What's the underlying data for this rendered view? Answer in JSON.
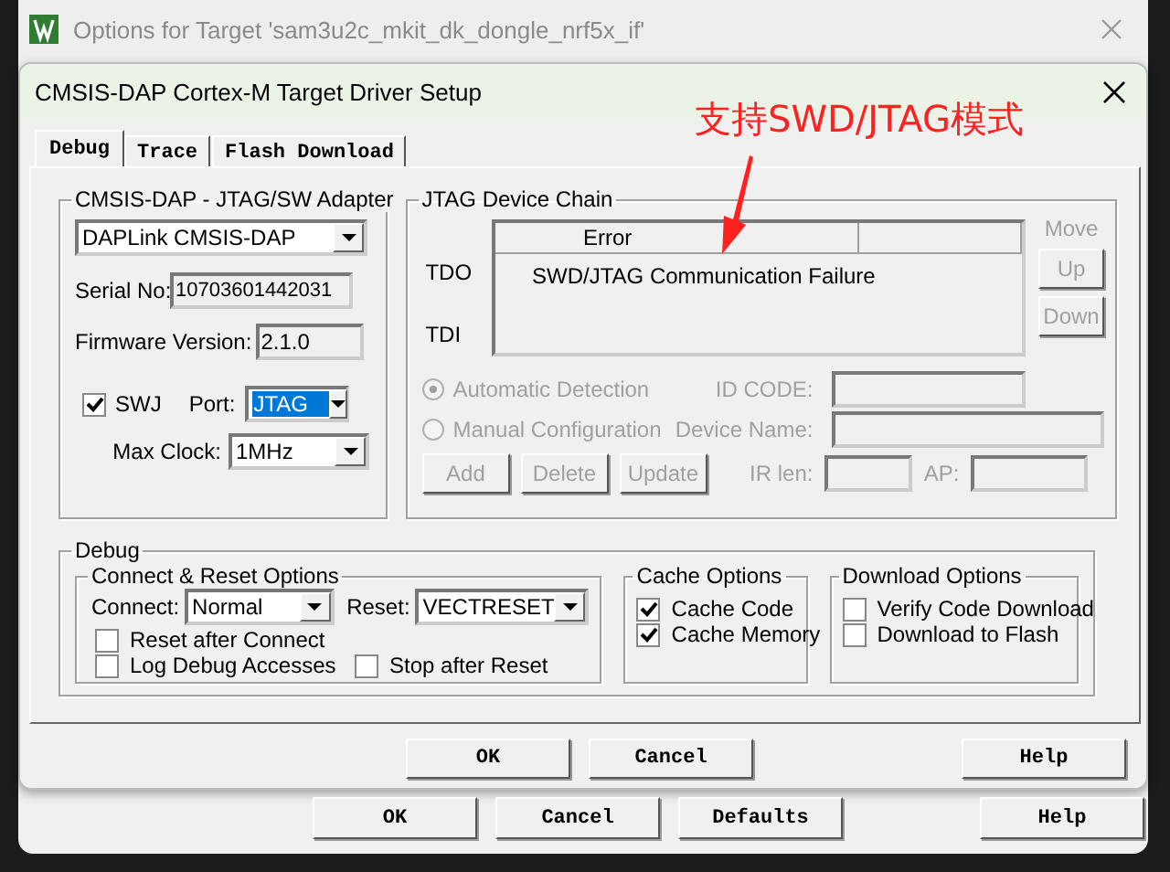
{
  "outer_window": {
    "title": "Options for Target 'sam3u2c_mkit_dk_dongle_nrf5x_if'",
    "buttons": [
      {
        "label": "OK"
      },
      {
        "label": "Cancel"
      },
      {
        "label": "Defaults"
      },
      {
        "label": "Help"
      }
    ]
  },
  "dialog": {
    "title": "CMSIS-DAP Cortex-M Target Driver Setup",
    "tabs": [
      {
        "label": "Debug",
        "selected": true
      },
      {
        "label": "Trace",
        "selected": false
      },
      {
        "label": "Flash Download",
        "selected": false
      }
    ],
    "adapter": {
      "legend": "CMSIS-DAP - JTAG/SW Adapter",
      "device": "DAPLink CMSIS-DAP",
      "serial_label": "Serial No:",
      "serial": "10703601442031",
      "firmware_label": "Firmware Version:",
      "firmware": "2.1.0",
      "swj": {
        "label": "SWJ",
        "checked": true
      },
      "port_label": "Port:",
      "port": "JTAG",
      "clock_label": "Max Clock:",
      "clock": "1MHz"
    },
    "chain": {
      "legend": "JTAG Device Chain",
      "tdo": "TDO",
      "tdi": "TDI",
      "columns": [
        "Error"
      ],
      "rows": [
        "SWD/JTAG Communication Failure"
      ],
      "move_label": "Move",
      "move_buttons": [
        {
          "label": "Up",
          "disabled": true
        },
        {
          "label": "Down",
          "disabled": true
        }
      ],
      "radios": [
        {
          "label": "Automatic Detection",
          "selected": true,
          "disabled": true
        },
        {
          "label": "Manual Configuration",
          "selected": false,
          "disabled": true
        }
      ],
      "id_code_label": "ID CODE:",
      "device_name_label": "Device Name:",
      "ir_len_label": "IR len:",
      "ap_label": "AP:",
      "buttons": [
        {
          "label": "Add",
          "disabled": true
        },
        {
          "label": "Delete",
          "disabled": true
        },
        {
          "label": "Update",
          "disabled": true
        }
      ]
    },
    "debug": {
      "legend": "Debug",
      "connect_reset": {
        "legend": "Connect & Reset Options",
        "connect_label": "Connect:",
        "connect": "Normal",
        "reset_label": "Reset:",
        "reset": "VECTRESET",
        "checks": [
          {
            "label": "Reset after Connect",
            "checked": false
          },
          {
            "label": "Log Debug Accesses",
            "checked": false
          },
          {
            "label": "Stop after Reset",
            "checked": false
          }
        ]
      },
      "cache": {
        "legend": "Cache Options",
        "checks": [
          {
            "label": "Cache Code",
            "checked": true
          },
          {
            "label": "Cache Memory",
            "checked": true
          }
        ]
      },
      "download": {
        "legend": "Download Options",
        "checks": [
          {
            "label": "Verify Code Download",
            "checked": false
          },
          {
            "label": "Download to Flash",
            "checked": false
          }
        ]
      }
    },
    "buttons": [
      {
        "label": "OK"
      },
      {
        "label": "Cancel"
      },
      {
        "label": "Help"
      }
    ]
  },
  "annotation": {
    "text": "支持SWD/JTAG模式"
  }
}
